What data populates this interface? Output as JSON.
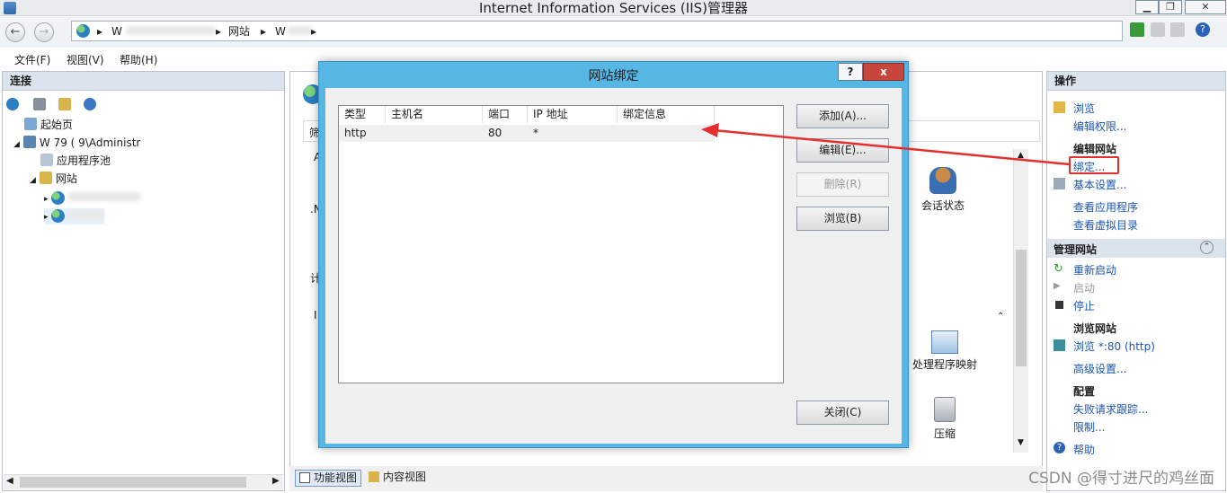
{
  "window": {
    "title": "Internet Information Services (IIS)管理器",
    "controls": [
      "▁",
      "❐",
      "✕"
    ]
  },
  "address": {
    "segments": [
      "W",
      "网站",
      "W"
    ]
  },
  "menu": [
    "文件(F)",
    "视图(V)",
    "帮助(H)"
  ],
  "left_panel": {
    "header": "连接",
    "tree": {
      "start_page": "起始页",
      "server": "W                79 (            9\\Administr",
      "app_pools": "应用程序池",
      "sites": "网站"
    }
  },
  "center_panel": {
    "visible_fragments": [
      "筛",
      "A",
      ".N",
      "计",
      "I"
    ],
    "icons": {
      "session_state": "会话状态",
      "handler_mappings": "处理程序映射",
      "compression": "压缩"
    },
    "bottom_tabs": [
      "功能视图",
      "内容视图"
    ]
  },
  "right_panel": {
    "header": "操作",
    "items": {
      "browse": "浏览",
      "edit_permissions": "编辑权限...",
      "edit_site_label": "编辑网站",
      "bindings": "绑定...",
      "basic_settings": "基本设置...",
      "view_apps": "查看应用程序",
      "view_vdirs": "查看虚拟目录",
      "manage_site": "管理网站",
      "restart": "重新启动",
      "start": "启动",
      "stop": "停止",
      "browse_site": "浏览网站",
      "browse_80": "浏览 *:80 (http)",
      "advanced_settings": "高级设置...",
      "config_label": "配置",
      "failed_request_tracing": "失败请求跟踪...",
      "limits": "限制...",
      "help": "帮助"
    }
  },
  "dialog": {
    "title": "网站绑定",
    "help_button": "?",
    "close_x": "x",
    "columns": [
      "类型",
      "主机名",
      "端口",
      "IP 地址",
      "绑定信息"
    ],
    "rows": [
      [
        "http",
        "",
        "80",
        "*",
        ""
      ]
    ],
    "buttons": {
      "add": "添加(A)...",
      "edit": "编辑(E)...",
      "remove": "删除(R)",
      "browse": "浏览(B)",
      "close": "关闭(C)"
    }
  },
  "watermark": "CSDN @得寸进尺的鸡丝面",
  "colors": {
    "dialog_frame": "#56b7e5",
    "annotation_red": "#e52e2e",
    "link_blue": "#1a56b4",
    "panel_header": "#dbe3ec"
  }
}
